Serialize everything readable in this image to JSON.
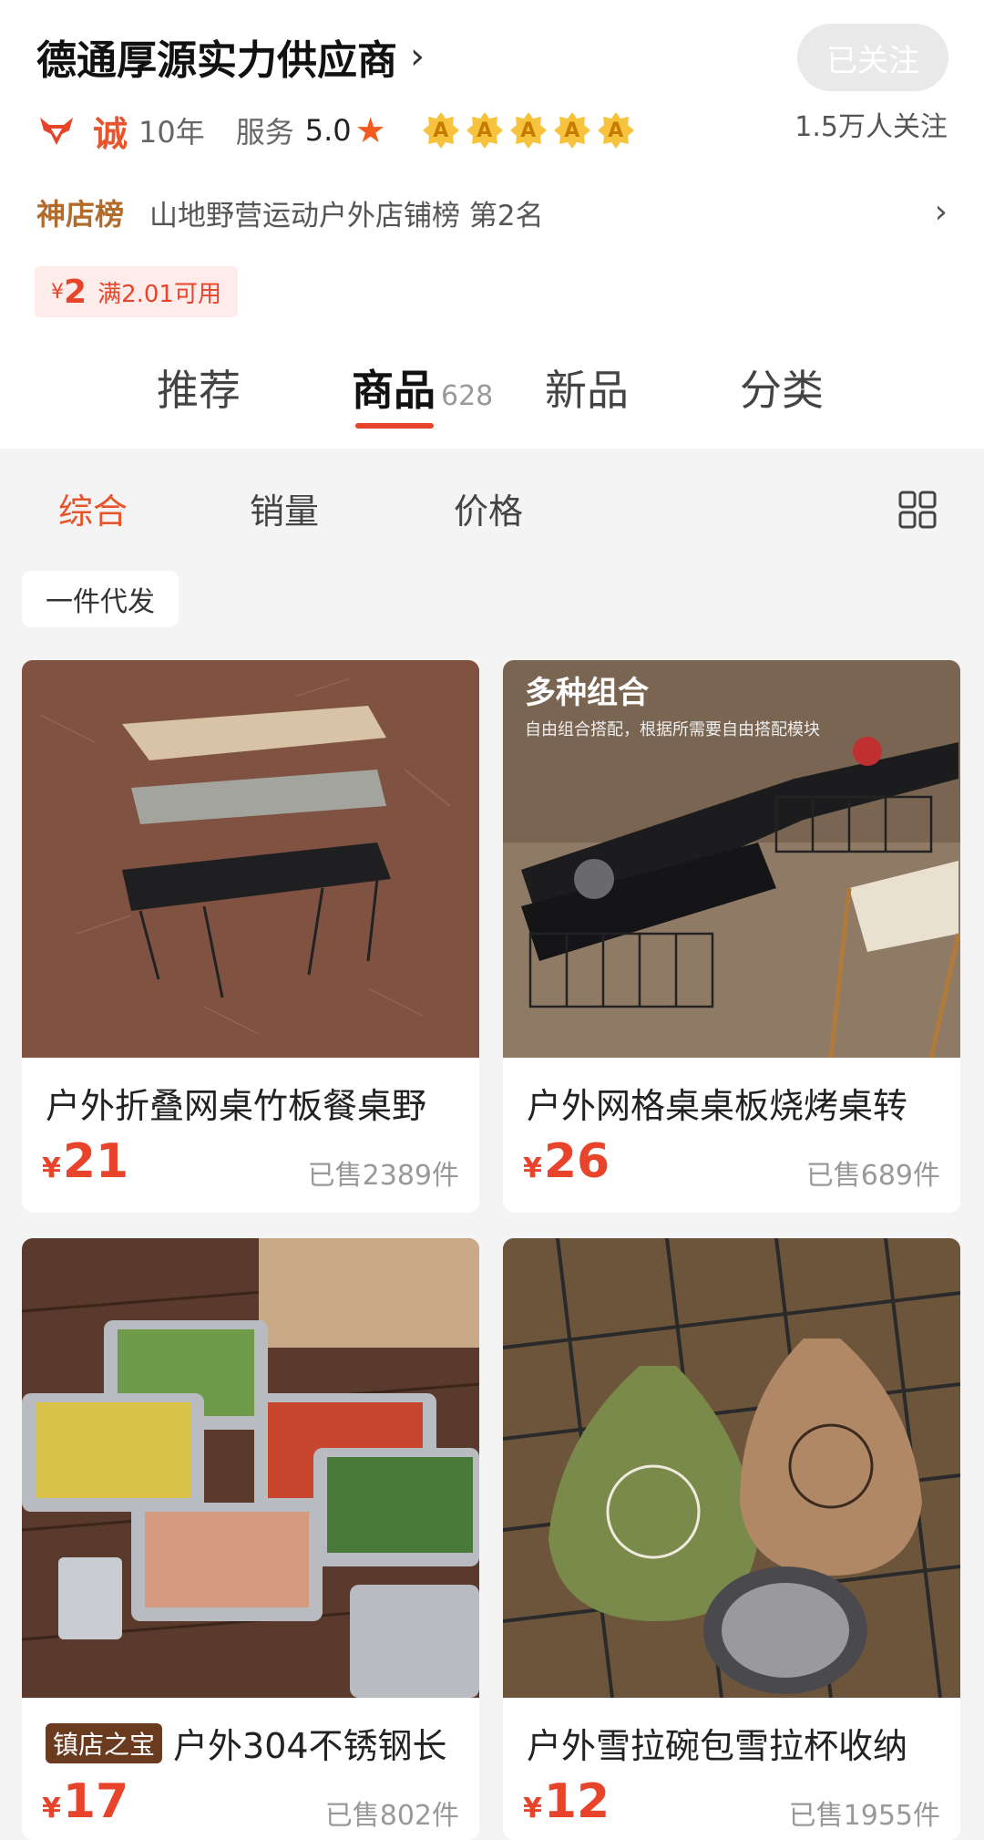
{
  "shop": {
    "name": "德通厚源实力供应商",
    "chevron": "›",
    "follow_label": "已关注",
    "fans": "1.5万人关注",
    "cheng": "诚",
    "years": "10年",
    "service_label": "服务",
    "service_score": "5.0",
    "star": "★",
    "badges": [
      "A",
      "A",
      "A",
      "A",
      "A"
    ],
    "rank_label": "神店榜",
    "rank_text": "山地野营运动户外店铺榜 第2名",
    "rank_chevron": "›"
  },
  "coupon": {
    "currency": "¥",
    "amount": "2",
    "condition": "满2.01可用"
  },
  "tabs": [
    {
      "label": "推荐"
    },
    {
      "label": "商品",
      "count": "628"
    },
    {
      "label": "新品"
    },
    {
      "label": "分类"
    }
  ],
  "sort": {
    "items": [
      "综合",
      "销量",
      "价格"
    ],
    "active": "综合"
  },
  "filter_chip": "一件代发",
  "products": [
    {
      "title": "户外折叠网桌竹板餐桌野",
      "currency": "¥",
      "price": "21",
      "sold": "已售2389件"
    },
    {
      "title": "户外网格桌桌板烧烤桌转",
      "currency": "¥",
      "price": "26",
      "sold": "已售689件",
      "image_title": "多种组合",
      "image_subtitle": "自由组合搭配，根据所需要自由搭配模块"
    },
    {
      "title": "户外304不锈钢长",
      "tag": "镇店之宝",
      "currency": "¥",
      "price": "17",
      "sold": "已售802件"
    },
    {
      "title": "户外雪拉碗包雪拉杯收纳",
      "currency": "¥",
      "price": "12",
      "sold": "已售1955件"
    }
  ],
  "colors": {
    "accent": "#e8442c",
    "rank_label": "#b36b2a",
    "tag_bg": "#6b3b1f"
  }
}
